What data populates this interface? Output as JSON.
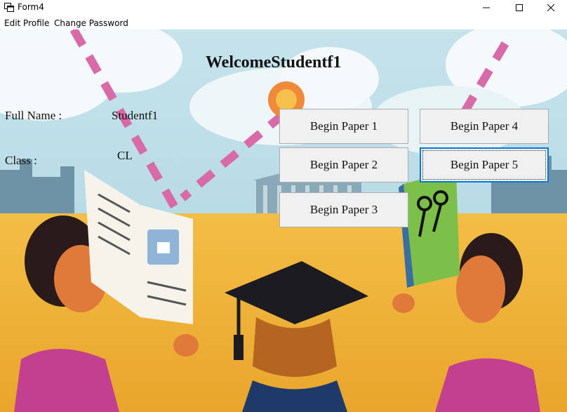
{
  "window": {
    "title": "Form4"
  },
  "menu": {
    "edit_profile": "Edit Profile",
    "change_password": "Change Password"
  },
  "main": {
    "welcome": "WelcomeStudentf1",
    "full_name_label": "Full Name :",
    "full_name_value": "Studentf1",
    "class_label": "Class :",
    "class_value": "CL"
  },
  "papers": {
    "p1": "Begin Paper 1",
    "p2": "Begin Paper 2",
    "p3": "Begin Paper 3",
    "p4": "Begin Paper 4",
    "p5": "Begin Paper 5"
  },
  "colors": {
    "sky": "#bfe0ea",
    "ground": "#f0b53a",
    "button_face": "#f0f0f0",
    "focus": "#0078d7"
  }
}
